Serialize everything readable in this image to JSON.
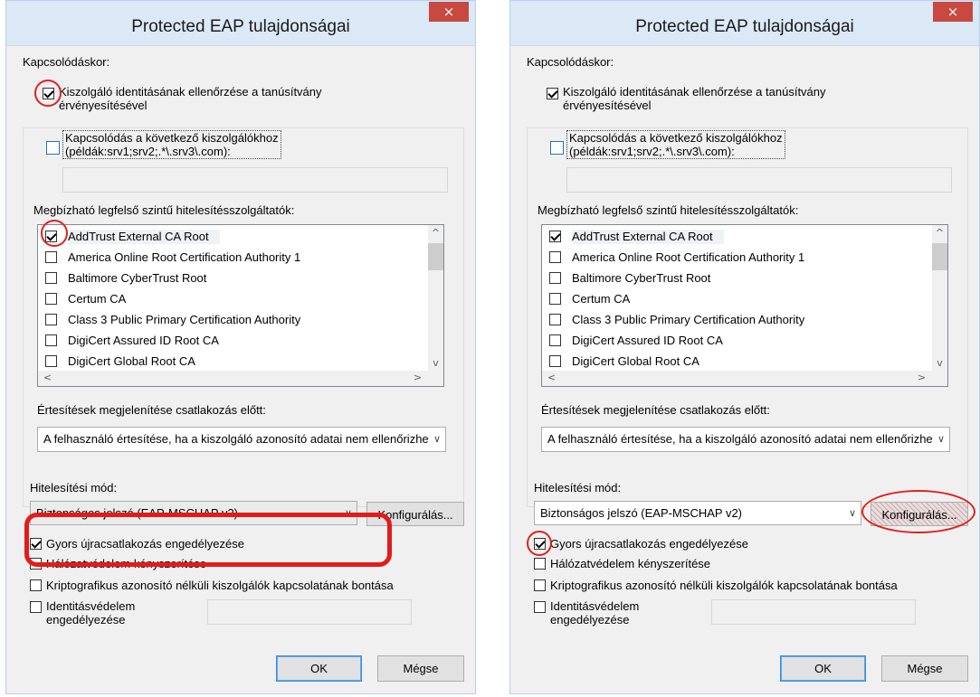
{
  "dialogs": [
    {
      "title": "Protected EAP tulajdonságai",
      "close_glyph": "×",
      "connect_heading": "Kapcsolódáskor:",
      "verify_server": {
        "line1": "Kiszolgáló identitásának ellenőrzése a tanúsítvány",
        "line2": "érvényesítésével",
        "checked": true
      },
      "connect_servers": {
        "line1": "Kapcsolódás a következő kiszolgálókhoz",
        "line2": "(példák:srv1;srv2;.*\\.srv3\\.com):",
        "checked": false
      },
      "servers_input_value": "",
      "ca_heading": "Megbízható legfelső szintű hitelesítésszolgáltatók:",
      "ca_list": [
        {
          "label": "AddTrust External CA Root",
          "checked": true
        },
        {
          "label": "America Online Root Certification Authority 1",
          "checked": false
        },
        {
          "label": "Baltimore CyberTrust Root",
          "checked": false
        },
        {
          "label": "Certum CA",
          "checked": false
        },
        {
          "label": "Class 3 Public Primary Certification Authority",
          "checked": false
        },
        {
          "label": "DigiCert Assured ID Root CA",
          "checked": false
        },
        {
          "label": "DigiCert Global Root CA",
          "checked": false
        }
      ],
      "scroll_up": "^",
      "scroll_down": "v",
      "scroll_left": "<",
      "scroll_right": ">",
      "notify_heading": "Értesítések megjelenítése csatlakozás előtt:",
      "notify_value": "A felhasználó értesítése, ha a kiszolgáló azonosító adatai nem ellenőrizhetők",
      "auth_heading": "Hitelesítési mód:",
      "auth_value": "Biztonságos jelszó (EAP-MSCHAP v2)",
      "configure_label": "Konfigurálás...",
      "fast_reconnect": {
        "label": "Gyors újracsatlakozás engedélyezése",
        "checked": true
      },
      "network_protection": {
        "label": "Hálózatvédelem kényszerítése",
        "checked": false
      },
      "crypto_binding": {
        "label": "Kriptografikus azonosító nélküli kiszolgálók kapcsolatának bontása",
        "checked": false
      },
      "identity_privacy": {
        "line1": "Identitásvédelem",
        "line2": "engedélyezése",
        "checked": false
      },
      "identity_input_value": "",
      "ok_label": "OK",
      "cancel_label": "Mégse"
    },
    {
      "title": "Protected EAP tulajdonságai",
      "close_glyph": "×",
      "connect_heading": "Kapcsolódáskor:",
      "verify_server": {
        "line1": "Kiszolgáló identitásának ellenőrzése a tanúsítvány",
        "line2": "érvényesítésével",
        "checked": true
      },
      "connect_servers": {
        "line1": "Kapcsolódás a következő kiszolgálókhoz",
        "line2": "(példák:srv1;srv2;.*\\.srv3\\.com):",
        "checked": false
      },
      "servers_input_value": "",
      "ca_heading": "Megbízható legfelső szintű hitelesítésszolgáltatók:",
      "ca_list": [
        {
          "label": "AddTrust External CA Root",
          "checked": true
        },
        {
          "label": "America Online Root Certification Authority 1",
          "checked": false
        },
        {
          "label": "Baltimore CyberTrust Root",
          "checked": false
        },
        {
          "label": "Certum CA",
          "checked": false
        },
        {
          "label": "Class 3 Public Primary Certification Authority",
          "checked": false
        },
        {
          "label": "DigiCert Assured ID Root CA",
          "checked": false
        },
        {
          "label": "DigiCert Global Root CA",
          "checked": false
        }
      ],
      "scroll_up": "^",
      "scroll_down": "v",
      "scroll_left": "<",
      "scroll_right": ">",
      "notify_heading": "Értesítések megjelenítése csatlakozás előtt:",
      "notify_value": "A felhasználó értesítése, ha a kiszolgáló azonosító adatai nem ellenőrizhetők",
      "auth_heading": "Hitelesítési mód:",
      "auth_value": "Biztonságos jelszó (EAP-MSCHAP v2)",
      "configure_label": "Konfigurálás...",
      "fast_reconnect": {
        "label": "Gyors újracsatlakozás engedélyezése",
        "checked": true
      },
      "network_protection": {
        "label": "Hálózatvédelem kényszerítése",
        "checked": false
      },
      "crypto_binding": {
        "label": "Kriptografikus azonosító nélküli kiszolgálók kapcsolatának bontása",
        "checked": false
      },
      "identity_privacy": {
        "line1": "Identitásvédelem",
        "line2": "engedélyezése",
        "checked": false
      },
      "identity_input_value": "",
      "ok_label": "OK",
      "cancel_label": "Mégse"
    }
  ],
  "colors": {
    "annotation": "#e21b1b",
    "titlebar": "#dbe8f6",
    "dialog_bg": "#f0f0f0",
    "close_button": "#c7493f"
  }
}
